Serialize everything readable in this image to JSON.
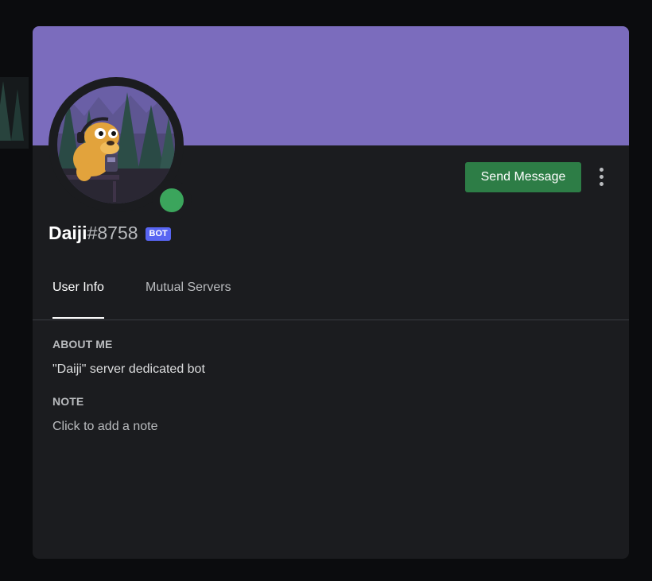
{
  "colors": {
    "banner": "#7b6cbd",
    "status_online": "#3ba55c",
    "send_button": "#2d7d46",
    "bot_tag": "#5865f2"
  },
  "profile": {
    "username": "Daiji",
    "discriminator": "#8758",
    "bot_tag": "BOT",
    "status": "online",
    "avatar_icon": "avatar-icon"
  },
  "actions": {
    "send_message_label": "Send Message",
    "more_icon": "more-vertical-icon"
  },
  "tabs": [
    {
      "label": "User Info",
      "active": true
    },
    {
      "label": "Mutual Servers",
      "active": false
    }
  ],
  "sections": {
    "about_me_title": "ABOUT ME",
    "about_me_text": "\"Daiji\" server dedicated bot",
    "note_title": "NOTE",
    "note_placeholder": "Click to add a note"
  }
}
